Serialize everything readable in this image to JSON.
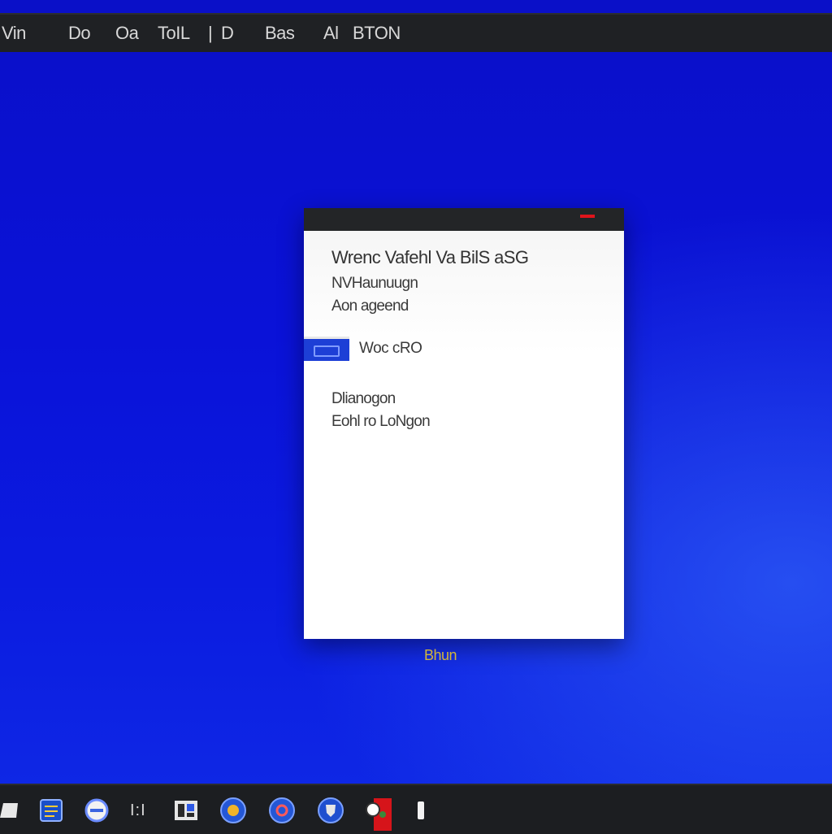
{
  "menubar": {
    "items": [
      "Vin",
      "Do",
      "Oa",
      "ToIL",
      "|",
      "D",
      "Bas",
      "Al",
      "BTON"
    ]
  },
  "dialog": {
    "title": "Wrenc Vafehl Va BilS aSG",
    "subtitle_1": "NVHaunuugn",
    "subtitle_2": "Aon ageend",
    "option_label": "Woc cRO",
    "detail_1": "Dlianogon",
    "detail_2": "Eohl ro LoNgon"
  },
  "below_dialog_label": "Bhun",
  "taskbar": {
    "text_item": "I:I",
    "icons": [
      "file-icon",
      "notepad-icon",
      "browser-icon",
      "app-grid-icon",
      "globe-icon",
      "settings-icon",
      "shield-icon",
      "media-icon",
      "battery-icon"
    ]
  },
  "colors": {
    "desktop": "#0a12d8",
    "bar": "#1f2124",
    "accent_blue": "#1d3fd6",
    "red_indicator": "#e0141b",
    "gold_label": "#d2b53a"
  }
}
